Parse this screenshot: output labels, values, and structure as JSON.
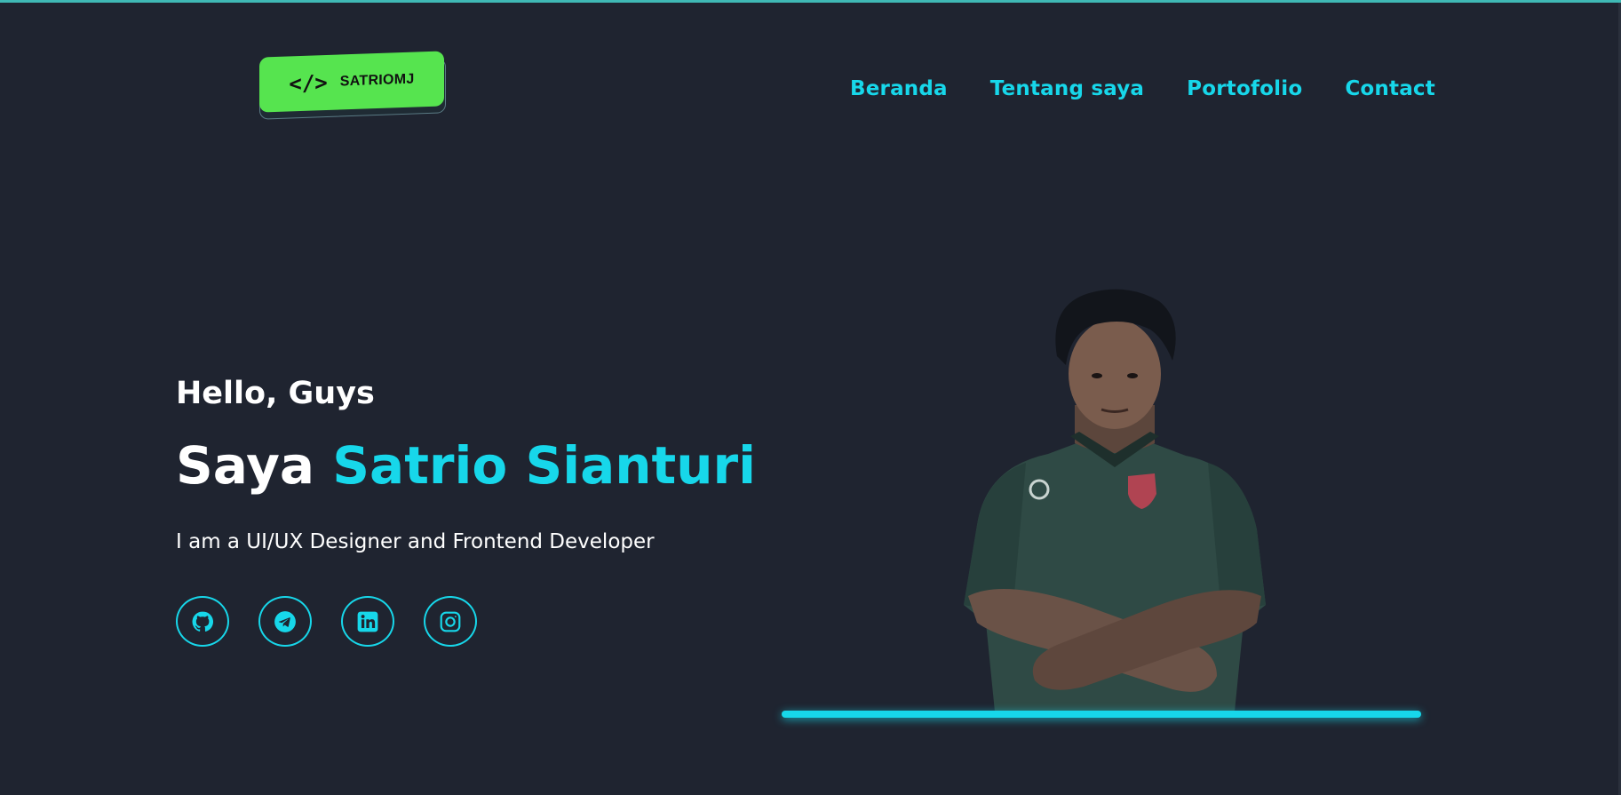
{
  "logo": {
    "code_glyph": "</>",
    "text": "SATRIOMJ",
    "color": "#56e44f"
  },
  "nav": {
    "items": [
      {
        "label": "Beranda"
      },
      {
        "label": "Tentang saya"
      },
      {
        "label": "Portofolio"
      },
      {
        "label": "Contact"
      }
    ],
    "color": "#17d7ea"
  },
  "hero": {
    "greeting": "Hello, Guys",
    "headline_prefix": "Saya",
    "headline_name": "Satrio Sianturi",
    "tagline": "I am a UI/UX Designer and Frontend Developer"
  },
  "social": [
    {
      "icon": "github-icon"
    },
    {
      "icon": "telegram-icon"
    },
    {
      "icon": "linkedin-icon"
    },
    {
      "icon": "instagram-icon"
    }
  ],
  "colors": {
    "background": "#1f2430",
    "accent": "#17d7ea",
    "text": "#ffffff"
  }
}
